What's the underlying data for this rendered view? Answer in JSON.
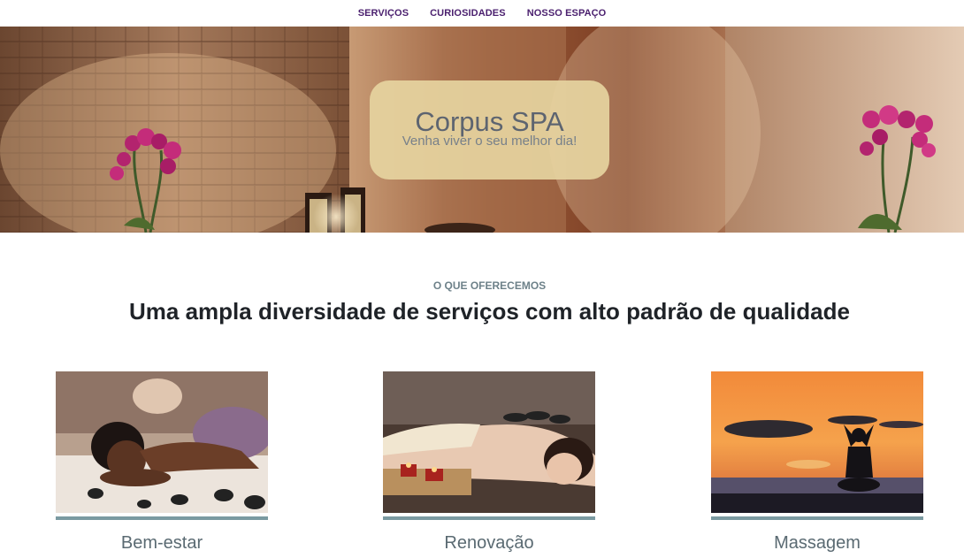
{
  "nav": {
    "items": [
      {
        "label": "SERVIÇOS"
      },
      {
        "label": "CURIOSIDADES"
      },
      {
        "label": "NOSSO ESPAÇO"
      }
    ]
  },
  "hero": {
    "title": "Corpus SPA",
    "subtitle": "Venha viver o seu melhor dia!"
  },
  "offer": {
    "kicker": "O QUE OFERECEMOS",
    "headline": "Uma ampla diversidade de serviços com alto padrão de qualidade"
  },
  "services": [
    {
      "label": "Bem-estar"
    },
    {
      "label": "Renovação"
    },
    {
      "label": "Massagem"
    }
  ],
  "colors": {
    "nav_text": "#4a1f6e",
    "card_bar": "#7a9aa1",
    "hero_card": "#e6d4a0"
  }
}
